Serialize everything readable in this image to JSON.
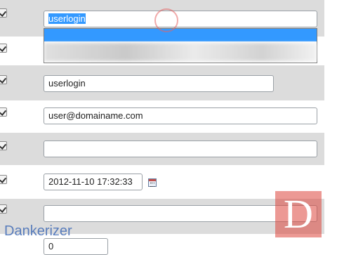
{
  "form": {
    "login_autocomplete": {
      "value": "userlogin"
    },
    "login": {
      "value": "userlogin"
    },
    "email": {
      "value": "user@domainame.com"
    },
    "blank_field_1": {
      "value": ""
    },
    "datetime": {
      "value": "2012-11-10 17:32:33"
    },
    "blank_field_2": {
      "value": ""
    },
    "number": {
      "value": "0"
    }
  },
  "watermark": {
    "text": "Dankerizer",
    "logo_letter": "D"
  },
  "colors": {
    "row_gray": "#dcdcdc",
    "highlight": "#3399ff",
    "logo": "#dc463c"
  },
  "icons": [
    "checkbox-checked",
    "calendar-icon"
  ]
}
